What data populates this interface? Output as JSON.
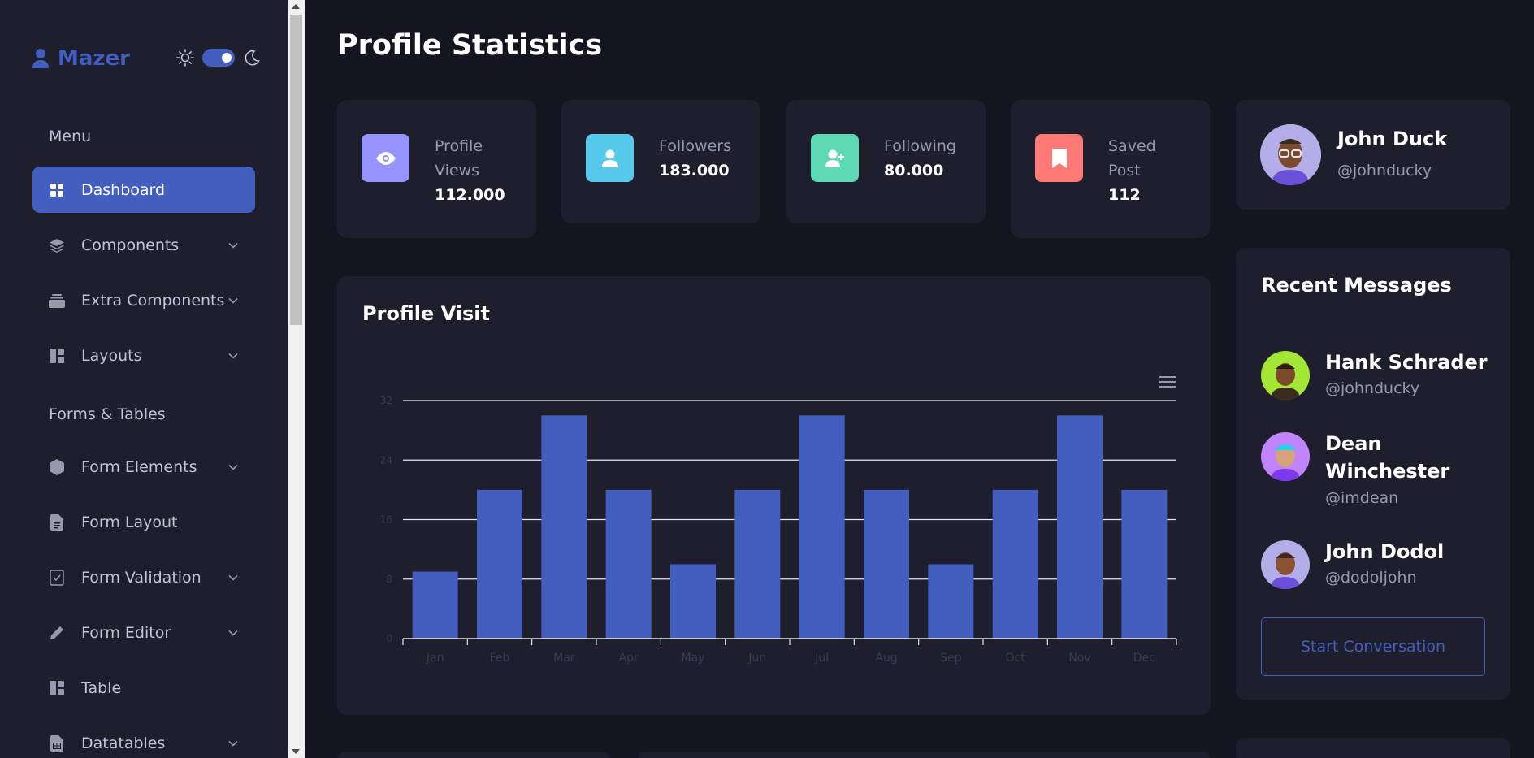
{
  "app": {
    "name": "Mazer"
  },
  "sidebar": {
    "sections": [
      {
        "title": "Menu"
      },
      {
        "title": "Forms & Tables"
      }
    ],
    "items": [
      {
        "label": "Dashboard",
        "icon": "grid-icon"
      },
      {
        "label": "Components",
        "icon": "stack-icon"
      },
      {
        "label": "Extra Components",
        "icon": "collection-icon"
      },
      {
        "label": "Layouts",
        "icon": "layout-icon"
      },
      {
        "label": "Form Elements",
        "icon": "hexagon-icon"
      },
      {
        "label": "Form Layout",
        "icon": "file-text-icon"
      },
      {
        "label": "Form Validation",
        "icon": "journal-check-icon"
      },
      {
        "label": "Form Editor",
        "icon": "pen-icon"
      },
      {
        "label": "Table",
        "icon": "table-icon"
      },
      {
        "label": "Datatables",
        "icon": "file-spreadsheet-icon"
      }
    ]
  },
  "page": {
    "title": "Profile Statistics"
  },
  "stats": [
    {
      "label": "Profile Views",
      "value": "112.000",
      "color": "#9694ff",
      "icon": "eye-icon"
    },
    {
      "label": "Followers",
      "value": "183.000",
      "color": "#57caeb",
      "icon": "person-icon"
    },
    {
      "label": "Following",
      "value": "80.000",
      "color": "#5ddab4",
      "icon": "person-add-icon"
    },
    {
      "label": "Saved Post",
      "value": "112",
      "color": "#ff7976",
      "icon": "bookmark-icon"
    }
  ],
  "profile": {
    "name": "John Duck",
    "handle": "@johnducky"
  },
  "visit_chart": {
    "title": "Profile Visit"
  },
  "chart_data": {
    "type": "bar",
    "categories": [
      "Jan",
      "Feb",
      "Mar",
      "Apr",
      "May",
      "Jun",
      "Jul",
      "Aug",
      "Sep",
      "Oct",
      "Nov",
      "Dec"
    ],
    "values": [
      9,
      20,
      30,
      20,
      10,
      20,
      30,
      20,
      10,
      20,
      30,
      20
    ],
    "title": "Profile Visit",
    "yticks": [
      "0",
      "8",
      "16",
      "24",
      "32"
    ],
    "ylim": [
      0,
      32
    ],
    "grid": true,
    "color": "#435ebe"
  },
  "messages": {
    "title": "Recent Messages",
    "items": [
      {
        "name": "Hank Schrader",
        "handle": "@johnducky"
      },
      {
        "name": "Dean Winchester",
        "handle": "@imdean"
      },
      {
        "name": "John Dodol",
        "handle": "@dodoljohn"
      }
    ],
    "button": "Start Conversation"
  }
}
